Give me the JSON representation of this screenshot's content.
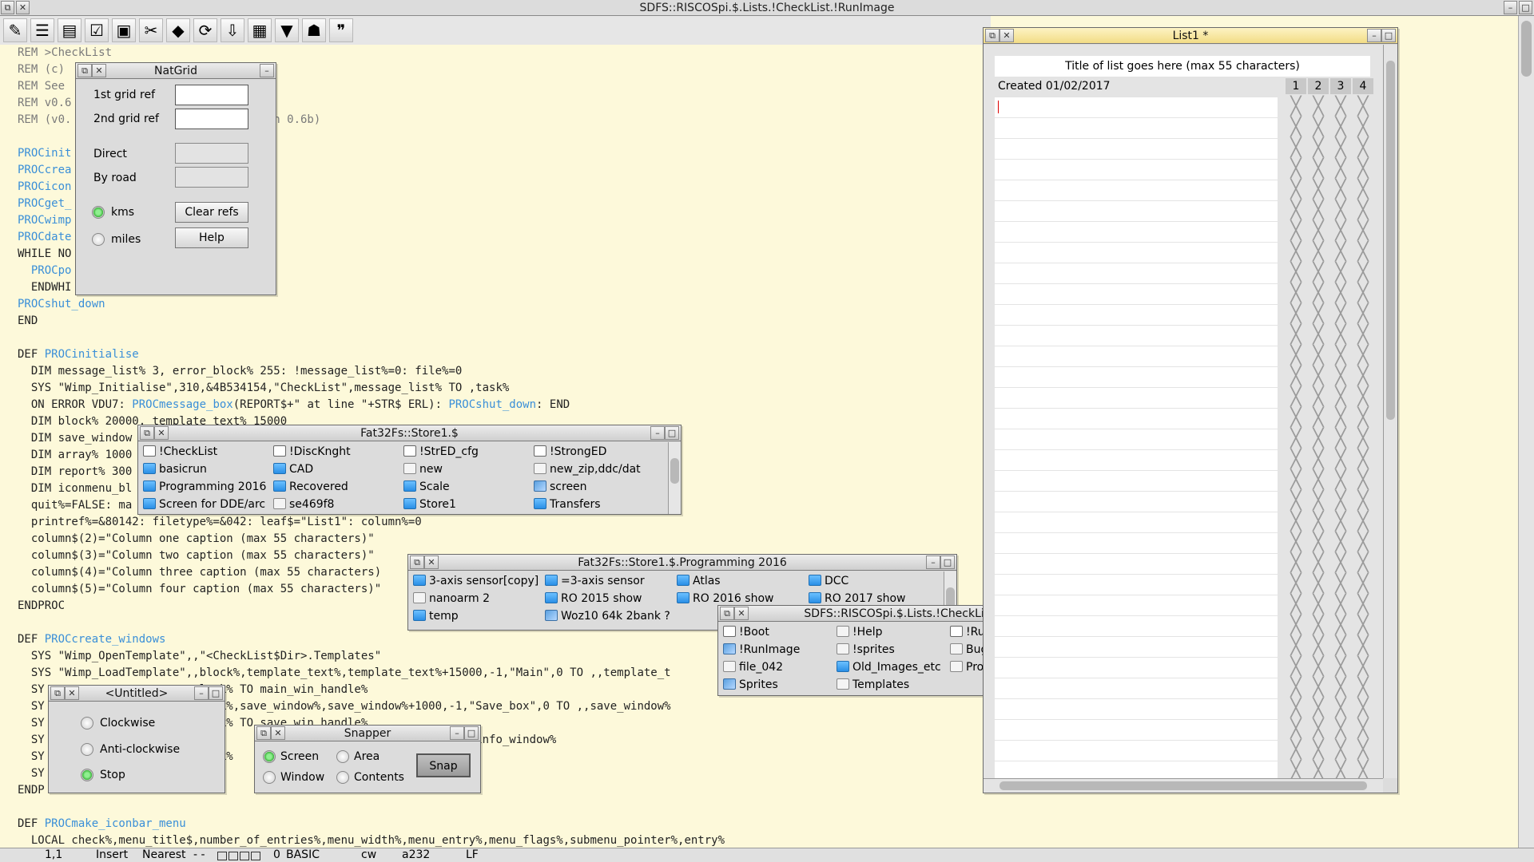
{
  "main_window": {
    "title": "SDFS::RISCOSpi.$.Lists.!CheckList.!RunImage",
    "toolbar": [
      "clipboard-icon",
      "list-icon",
      "book-icon",
      "check-icon",
      "save-icon",
      "cut-icon",
      "stop-icon",
      "refresh-icon",
      "download-icon",
      "film-icon",
      "flag-icon",
      "run-icon",
      "footprints-icon"
    ],
    "code_lines": [
      {
        "text": "REM >CheckList",
        "style": "rem"
      },
      {
        "text": "REM (c)",
        "style": "rem"
      },
      {
        "text": "REM See                              s",
        "style": "rem"
      },
      {
        "text": "REM v0.6",
        "style": "rem"
      },
      {
        "text": "REM (v0.                       fixed in 0.6b)",
        "style": "rem"
      },
      {
        "text": "",
        "style": ""
      },
      {
        "text": "PROCinit",
        "style": "kw"
      },
      {
        "text": "PROCcrea",
        "style": "kw"
      },
      {
        "text": "PROCicon",
        "style": "kw"
      },
      {
        "text": "PROCget_",
        "style": "kw"
      },
      {
        "text": "PROCwimp",
        "style": "kw"
      },
      {
        "text": "PROCdate",
        "style": "kw"
      },
      {
        "text": "WHILE NO",
        "style": ""
      },
      {
        "text": "  PROCpo",
        "style": "kw"
      },
      {
        "text": "  ENDWHI",
        "style": ""
      },
      {
        "text": "PROCshut_down",
        "style": "kw"
      },
      {
        "text": "END",
        "style": ""
      },
      {
        "text": "",
        "style": ""
      },
      {
        "text": "DEF PROCinitialise",
        "style": "def"
      },
      {
        "text": "  DIM message_list% 3, error_block% 255: !message_list%=0: file%=0",
        "style": ""
      },
      {
        "text": "  SYS \"Wimp_Initialise\",310,&4B534154,\"CheckList\",message_list% TO ,task%",
        "style": ""
      },
      {
        "text": "  ON ERROR VDU7: PROCmessage_box(REPORT$+\" at line \"+STR$ ERL): PROCshut_down: END",
        "style": "err"
      },
      {
        "text": "  DIM block% 20000, template_text% 15000",
        "style": ""
      },
      {
        "text": "  DIM save_window",
        "style": ""
      },
      {
        "text": "  DIM array% 1000",
        "style": ""
      },
      {
        "text": "  DIM report% 300",
        "style": ""
      },
      {
        "text": "  DIM iconmenu_bl",
        "style": ""
      },
      {
        "text": "  quit%=FALSE: ma",
        "style": ""
      },
      {
        "text": "  printref%=&80142: filetype%=&042: leaf$=\"List1\": column%=0",
        "style": ""
      },
      {
        "text": "  column$(2)=\"Column one caption (max 55 characters)\"",
        "style": ""
      },
      {
        "text": "  column$(3)=\"Column two caption (max 55 characters)\"",
        "style": ""
      },
      {
        "text": "  column$(4)=\"Column three caption (max 55 characters)",
        "style": ""
      },
      {
        "text": "  column$(5)=\"Column four caption (max 55 characters)\"",
        "style": ""
      },
      {
        "text": "ENDPROC",
        "style": ""
      },
      {
        "text": "",
        "style": ""
      },
      {
        "text": "DEF PROCcreate_windows",
        "style": "def"
      },
      {
        "text": "  SYS \"Wimp_OpenTemplate\",,\"<CheckList$Dir>.Templates\"",
        "style": ""
      },
      {
        "text": "  SYS \"Wimp_LoadTemplate\",,block%,template_text%,template_text%+15000,-1,\"Main\",0 TO ,,template_t",
        "style": ""
      },
      {
        "text": "  SY                       lock% TO main_win_handle%",
        "style": ""
      },
      {
        "text": "  SY                       lock%,save_window%,save_window%+1000,-1,\"Save_box\",0 TO ,,save_window%",
        "style": ""
      },
      {
        "text": "  SY                       lock% TO save_win_handle%",
        "style": ""
      },
      {
        "text": "  SY                                               -1,\"Info\",0 TO ,,info_window%",
        "style": ""
      },
      {
        "text": "  SY                       lock%",
        "style": ""
      },
      {
        "text": "  SY",
        "style": ""
      },
      {
        "text": "ENDP",
        "style": ""
      },
      {
        "text": "",
        "style": ""
      },
      {
        "text": "DEF PROCmake_iconbar_menu",
        "style": "def"
      },
      {
        "text": "  LOCAL check%,menu_title$,number_of_entries%,menu_width%,menu_entry%,menu_flags%,submenu_pointer%,entry%",
        "style": ""
      }
    ],
    "status": {
      "position": "1,1",
      "mode": "Insert",
      "search": "Nearest",
      "flags": "- -",
      "count": "0",
      "lang": "BASIC",
      "wrap": "cw",
      "code": "a232",
      "eol": "LF"
    }
  },
  "natgrid": {
    "title": "NatGrid",
    "first_ref_label": "1st grid ref",
    "second_ref_label": "2nd grid ref",
    "first_ref_value": "",
    "second_ref_value": "",
    "direct_label": "Direct",
    "road_label": "By road",
    "direct_value": "",
    "road_value": "",
    "unit_kms": "kms",
    "unit_miles": "miles",
    "clear_label": "Clear refs",
    "help_label": "Help",
    "selected_unit": "kms"
  },
  "store1": {
    "title": "Fat32Fs::Store1.$",
    "items": [
      {
        "name": "!CheckList",
        "type": "app"
      },
      {
        "name": "!DiscKnght",
        "type": "app"
      },
      {
        "name": "!StrED_cfg",
        "type": "app"
      },
      {
        "name": "!StrongED",
        "type": "app"
      },
      {
        "name": "basicrun",
        "type": "dir"
      },
      {
        "name": "CAD",
        "type": "dir"
      },
      {
        "name": "new",
        "type": "file"
      },
      {
        "name": "new_zip,ddc/dat",
        "type": "file"
      },
      {
        "name": "Programming 2016",
        "type": "dir"
      },
      {
        "name": "Recovered",
        "type": "dir"
      },
      {
        "name": "Scale",
        "type": "dir"
      },
      {
        "name": "screen",
        "type": "spr"
      },
      {
        "name": "Screen for DDE/arc",
        "type": "dir"
      },
      {
        "name": "se469f8",
        "type": "file"
      },
      {
        "name": "Store1",
        "type": "dir"
      },
      {
        "name": "Transfers",
        "type": "dir"
      }
    ]
  },
  "programming": {
    "title": "Fat32Fs::Store1.$.Programming 2016",
    "items": [
      {
        "name": "3-axis sensor[copy]",
        "type": "dir"
      },
      {
        "name": "=3-axis sensor",
        "type": "dir"
      },
      {
        "name": "Atlas",
        "type": "dir"
      },
      {
        "name": "DCC",
        "type": "dir"
      },
      {
        "name": "nanoarm 2",
        "type": "file"
      },
      {
        "name": "RO 2015 show",
        "type": "dir"
      },
      {
        "name": "RO 2016 show",
        "type": "dir"
      },
      {
        "name": "RO 2017 show",
        "type": "dir"
      },
      {
        "name": "temp",
        "type": "dir"
      },
      {
        "name": "Woz10 64k 2bank ?",
        "type": "spr"
      }
    ]
  },
  "checklist_dir": {
    "title": "SDFS::RISCOSpi.$.Lists.!CheckList",
    "items": [
      {
        "name": "!Boot",
        "type": "app"
      },
      {
        "name": "!Help",
        "type": "file"
      },
      {
        "name": "!Run",
        "type": "app"
      },
      {
        "name": "!RunImage",
        "type": "spr"
      },
      {
        "name": "!sprites",
        "type": "file"
      },
      {
        "name": "Bugs",
        "type": "file"
      },
      {
        "name": "file_042",
        "type": "file"
      },
      {
        "name": "Old_Images_etc",
        "type": "dir"
      },
      {
        "name": "Prog notes",
        "type": "file"
      },
      {
        "name": "Sprites",
        "type": "spr"
      },
      {
        "name": "Templates",
        "type": "file"
      }
    ]
  },
  "untitled": {
    "title": "<Untitled>",
    "options": [
      "Clockwise",
      "Anti-clockwise",
      "Stop"
    ],
    "selected": "Stop"
  },
  "snapper": {
    "title": "Snapper",
    "screen_label": "Screen",
    "area_label": "Area",
    "window_label": "Window",
    "contents_label": "Contents",
    "snap_label": "Snap",
    "selected": "Screen"
  },
  "list1": {
    "title": "List1 *",
    "list_title": "Title of list goes here (max 55 characters)",
    "created": "Created 01/02/2017",
    "columns": [
      "1",
      "2",
      "3",
      "4"
    ],
    "row_count": 33
  }
}
